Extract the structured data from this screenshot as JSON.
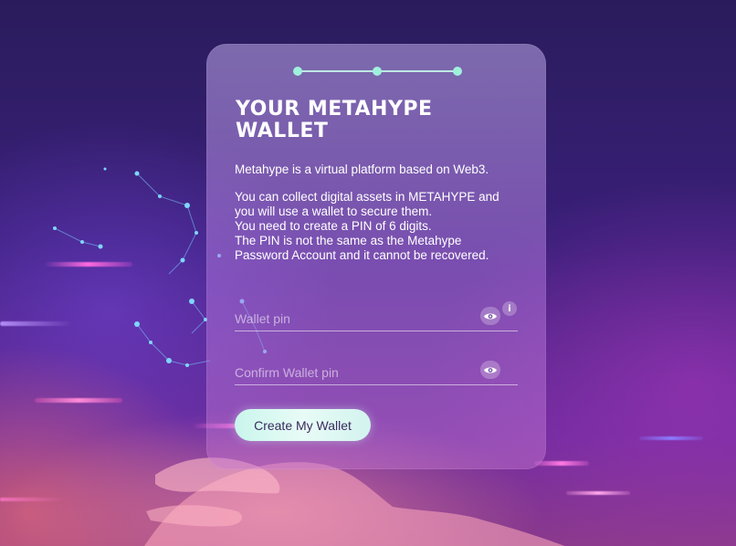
{
  "stepper": {
    "total_steps": 3,
    "active_step": 1,
    "colors": {
      "dot": "#9ff0dc",
      "line": "#bfe9e4"
    }
  },
  "card": {
    "title_line1": "YOUR METAHYPE",
    "title_line2": "WALLET",
    "intro": "Metahype is a virtual platform based on Web3.",
    "body_lines": [
      "You can collect digital assets in METAHYPE and",
      "you will use a wallet to secure them.",
      "You need to create a PIN of 6 digits.",
      "The PIN is not the same as the Metahype",
      "Password Account and it cannot be recovered."
    ]
  },
  "form": {
    "wallet_pin": {
      "placeholder": "Wallet pin",
      "value": "",
      "visibility_icon": "eye-icon",
      "info_icon": "info-icon",
      "info_label": "i"
    },
    "confirm_pin": {
      "placeholder": "Confirm Wallet pin",
      "value": "",
      "visibility_icon": "eye-icon"
    },
    "submit_label": "Create My Wallet"
  },
  "theme": {
    "accent": "#9ff0dc",
    "button_text": "#3a2a5e",
    "text": "#ffffff"
  }
}
